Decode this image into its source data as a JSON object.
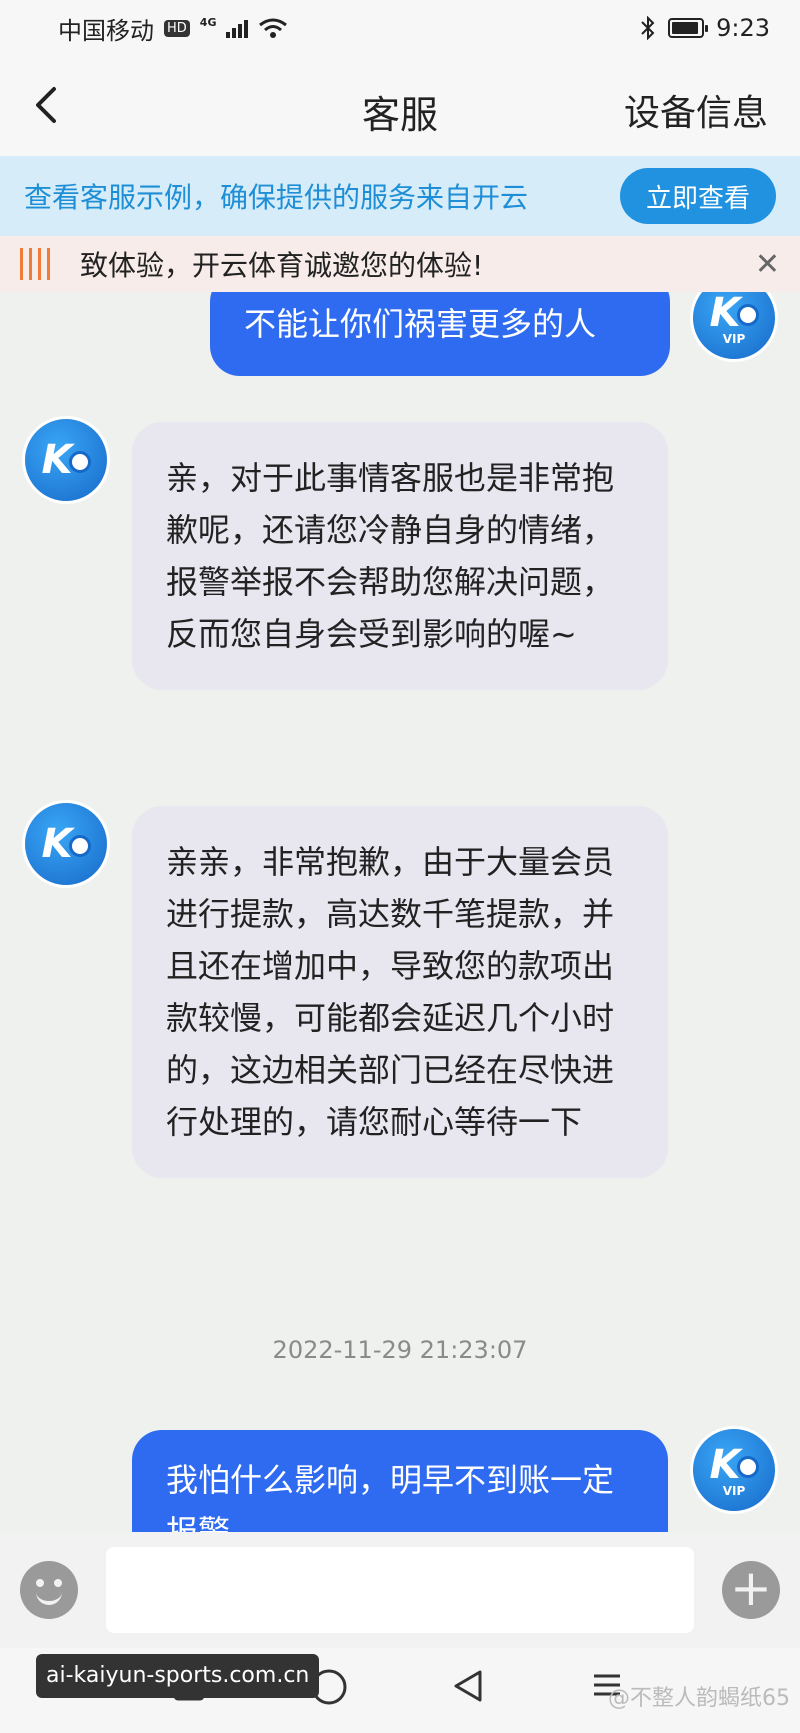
{
  "status_bar": {
    "carrier": "中国移动",
    "hd_badge": "HD",
    "network": "4G",
    "time": "9:23"
  },
  "nav": {
    "title": "客服",
    "right_label": "设备信息"
  },
  "banner": {
    "text": "查看客服示例，确保提供的服务来自开云",
    "button_label": "立即查看"
  },
  "notice": {
    "text": "致体验，开云体育诚邀您的体验!"
  },
  "messages": [
    {
      "direction": "out",
      "text": "不能让你们祸害更多的人"
    },
    {
      "direction": "in",
      "text": "亲，对于此事情客服也是非常抱歉呢，还请您冷静自身的情绪，报警举报不会帮助您解决问题，反而您自身会受到影响的喔~"
    },
    {
      "direction": "in",
      "text": "亲亲，非常抱歉，由于大量会员进行提款，高达数千笔提款，并且还在增加中，导致您的款项出款较慢，可能都会延迟几个小时的，这边相关部门已经在尽快进行处理的，请您耐心等待一下"
    },
    {
      "direction": "out",
      "text": "我怕什么影响，明早不到账一定报警"
    }
  ],
  "timestamp": "2022-11-29 21:23:07",
  "avatar": {
    "logo": "K",
    "vip": "VIP"
  },
  "input": {
    "value": "",
    "placeholder": ""
  },
  "watermarks": {
    "left": "ai-kaiyun-sports.com.cn",
    "right": "@不整人韵蝎纸65"
  },
  "colors": {
    "accent": "#2192e0",
    "outgoing_bubble": "#2f6bf0",
    "incoming_bubble": "#e8e6ef",
    "notice_icon": "#f07c3a"
  }
}
